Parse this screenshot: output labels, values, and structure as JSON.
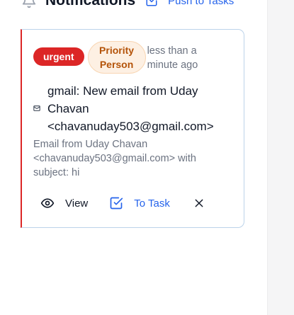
{
  "header": {
    "title": "Notifications",
    "push_label": "Push to Tasks"
  },
  "notification": {
    "badges": {
      "urgent": "urgent",
      "priority_line1": "Priority",
      "priority_line2": "Person"
    },
    "time_line1": "less than a",
    "time_line2": "minute ago",
    "subject": "gmail: New email from Uday Chavan <chavanuday503@gmail.com>",
    "body": "Email from Uday Chavan <chavanuday503@gmail.com> with subject: hi",
    "actions": {
      "view_label": "View",
      "to_task_label": "To Task"
    },
    "icons": {
      "header": "bell-icon",
      "push": "task-check-icon",
      "mail": "envelope-icon",
      "view": "eye-icon",
      "to_task": "task-check-icon",
      "dismiss": "close-icon"
    },
    "colors": {
      "urgent": "#dc2626",
      "priority_bg": "#fdf0e3",
      "priority_text": "#b45309",
      "link": "#2563eb"
    }
  }
}
